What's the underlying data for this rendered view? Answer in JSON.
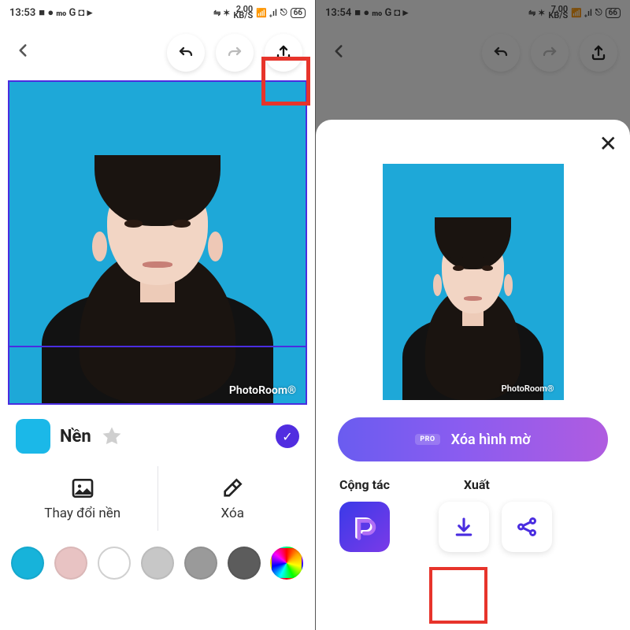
{
  "status": {
    "left": {
      "time": "13:53",
      "speed": "2,00",
      "speed_unit": "KB/S"
    },
    "right": {
      "time": "13:54",
      "speed": "7,00",
      "speed_unit": "KB/S"
    },
    "battery": "66"
  },
  "editor": {
    "watermark": "PhotoRoom®",
    "layer_label": "Nền",
    "tiles": {
      "change_bg": "Thay đổi nền",
      "erase": "Xóa"
    },
    "colors": [
      "#17b3da",
      "#e8bfbf",
      "#ffffff",
      "#b8b8b8",
      "#8f8f8f",
      "#595959",
      "rainbow"
    ]
  },
  "export_sheet": {
    "remove_watermark": "Xóa hình mờ",
    "pro_tag": "PRO",
    "collab_section": "Cộng tác",
    "export_section": "Xuất"
  }
}
